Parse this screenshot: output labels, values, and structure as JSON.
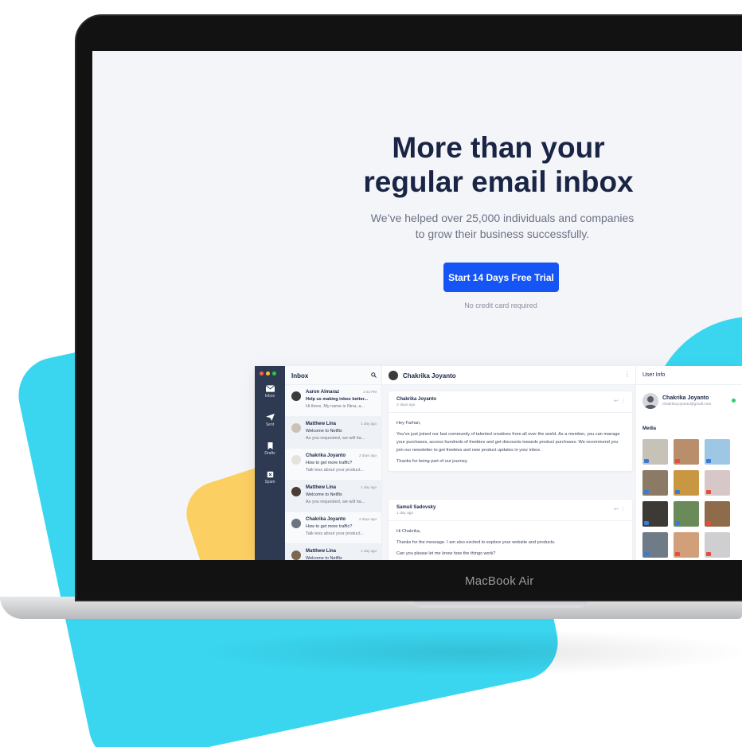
{
  "hero": {
    "title_line1": "More than your",
    "title_line2": "regular email inbox",
    "subtitle_line1": "We’ve helped over 25,000 individuals and companies",
    "subtitle_line2": "to grow their business successfully.",
    "cta_label": "Start 14 Days Free Trial",
    "cta_note": "No credit card required"
  },
  "device": {
    "brand": "MacBook Air"
  },
  "colors": {
    "cta": "#1555f5",
    "accent_cyan": "#3ad6f0",
    "accent_yellow": "#fbcf62",
    "rail": "#2e3a52"
  },
  "app": {
    "window_dots": [
      "#ff5f56",
      "#ffbd2e",
      "#27c93f"
    ],
    "rail": [
      {
        "label": "Inbox",
        "icon": "mail-icon"
      },
      {
        "label": "Sent",
        "icon": "send-icon"
      },
      {
        "label": "Drafts",
        "icon": "bookmark-icon"
      },
      {
        "label": "Spam",
        "icon": "spam-icon"
      }
    ],
    "list_title": "Inbox",
    "messages": [
      {
        "name": "Aaron Almaraz",
        "time": "2:43 PM",
        "subject": "Help us making inbox better...",
        "preview": "Hi there, My name is Nina, a...",
        "bold": true
      },
      {
        "name": "Matthew Lina",
        "time": "1 day ago",
        "subject": "Welcome to Netflix",
        "preview": "As you requested, we will ha..."
      },
      {
        "name": "Chakrika Joyanto",
        "time": "2 days ago",
        "subject": "How to get more traffic?",
        "preview": "Talk less about your product..."
      },
      {
        "name": "Matthew Lina",
        "time": "1 day ago",
        "subject": "Welcome to Netflix",
        "preview": "As you requested, we will ha..."
      },
      {
        "name": "Chakrika Joyanto",
        "time": "2 days ago",
        "subject": "How to get more traffic?",
        "preview": "Talk less about your product..."
      },
      {
        "name": "Matthew Lina",
        "time": "1 day ago",
        "subject": "Welcome to Netflix",
        "preview": ""
      }
    ],
    "thread": {
      "contact": "Chakrika Joyanto",
      "cards": [
        {
          "name": "Chakrika Joyanto",
          "time": "2 days ago",
          "greeting": "Hey Farhan,",
          "body": "You’ve just joined our fast community of talented creatives from all over the world. As a member, you can manage your purchases, access hundreds of freebies and get discounts towards product purchases. We recommend you join our newsletter to get freebies and new product updates in your inbox.",
          "closing": "Thanks for being part of our journey."
        },
        {
          "name": "Samuil Sadovsky",
          "time": "1 day ago",
          "greeting": "Hi Chakrika,",
          "body": "Thanks for the message. I am also excited to explore your website and products.",
          "closing": "Can you please let me know how the things work?"
        }
      ]
    },
    "info": {
      "title": "User Info",
      "name": "Chakrika Joyanto",
      "email": "chakrika.joyanto@gmail.com",
      "media_label": "Media",
      "thumb_colors": [
        "#c7c2b8",
        "#b98e6b",
        "#9ec7e6",
        "#8b7a66",
        "#c99642",
        "#d8c7c7",
        "#3d3a35",
        "#6a8a5a",
        "#8e6b4a",
        "#6f7b87",
        "#d1a07a",
        "#cfcfd1"
      ],
      "tag_colors": [
        "#3a7bd5",
        "#e74c3c",
        "#3a7bd5",
        "#3a7bd5",
        "#3a7bd5",
        "#e74c3c",
        "#3a7bd5",
        "#3a7bd5",
        "#e74c3c",
        "#3a7bd5",
        "#e74c3c",
        "#e74c3c"
      ]
    }
  }
}
